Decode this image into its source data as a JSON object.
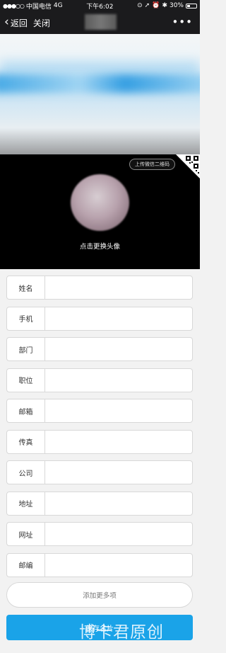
{
  "status_bar": {
    "signal_dots": "●●●○○",
    "carrier": "中国电信",
    "network": "4G",
    "time": "下午6:02",
    "battery": "30%",
    "battery_level": 0.3
  },
  "nav": {
    "back_label": "返回",
    "close_label": "关闭",
    "more_label": "•••"
  },
  "avatar": {
    "upload_qr_label": "上传微信二维码",
    "change_avatar_label": "点击更换头像"
  },
  "form": {
    "fields": [
      {
        "label": "姓名",
        "value": ""
      },
      {
        "label": "手机",
        "value": ""
      },
      {
        "label": "部门",
        "value": ""
      },
      {
        "label": "职位",
        "value": ""
      },
      {
        "label": "邮箱",
        "value": ""
      },
      {
        "label": "传真",
        "value": ""
      },
      {
        "label": "公司",
        "value": ""
      },
      {
        "label": "地址",
        "value": ""
      },
      {
        "label": "网址",
        "value": ""
      },
      {
        "label": "邮编",
        "value": ""
      }
    ],
    "add_more_label": "添加更多项",
    "save_label": "保存名片"
  },
  "watermark": "博卡君原创",
  "colors": {
    "bar_bg": "#1b1b1d",
    "save_button": "#1aa3e8",
    "page_bg": "#f2f2f2"
  }
}
